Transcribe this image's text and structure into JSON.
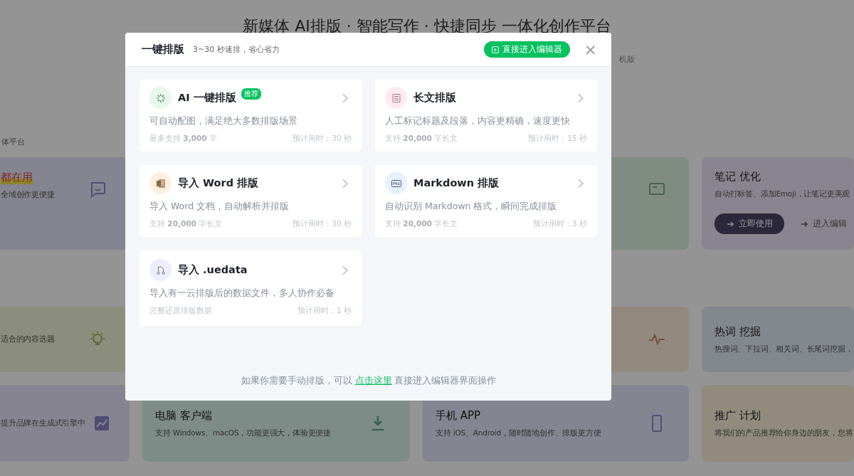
{
  "page": {
    "headline": "新媒体 AI排版 · 智能写作 · 快捷同步 一体化创作平台",
    "subtitle": "机版",
    "section_label": "体平台",
    "rows": [
      [
        {
          "title": "都在用",
          "highlighted": true,
          "description": "全域创作更便捷"
        },
        {
          "title": "笔记 优化",
          "highlighted": false,
          "description": "自动打标签、添加Emoji，让笔记更美观",
          "primary_button": "立即使用",
          "secondary_link": "进入编辑"
        }
      ],
      [
        {
          "description": "适合的内容选题"
        },
        {
          "title": "热词 挖掘",
          "highlighted": false,
          "description": "热搜词、下拉词、相关词、长尾词挖掘，"
        }
      ],
      [
        {
          "description": "提升品牌在生成式引擎中"
        },
        {
          "title": "电脑 客户端",
          "highlighted": false,
          "description": "支持 Windows、macOS，功能更强大，体验更便捷"
        },
        {
          "title": "手机 APP",
          "highlighted": false,
          "description": "支持 iOS、Android，随时随地创作、排版更方便"
        },
        {
          "title": "推广 计划",
          "highlighted": false,
          "description": "将我们的产品推荐给你身边的朋友，您将"
        }
      ]
    ]
  },
  "dialog": {
    "title": "一键排版",
    "subtitle": "3~30 秒速排，省心省力",
    "editor_button": "直接进入编辑器",
    "close": "×",
    "options": [
      {
        "title": "AI 一键排版",
        "badge": "推荐",
        "description": "可自动配图，满足绝大多数排版场景",
        "limit": "最多支持 **3,000** 字",
        "time": "预计用时：30 秒",
        "color": "#e6f9ec"
      },
      {
        "title": "长文排版",
        "description": "人工标记标题及段落，内容更精确，速度更快",
        "limit": "支持 **20,000** 字长文",
        "time": "预计用时：15 秒",
        "color": "#fdecef"
      },
      {
        "title": "导入 Word 排版",
        "description": "导入 Word 文档，自动解析并排版",
        "limit": "支持 **20,000** 字长文",
        "time": "预计用时：30 秒",
        "color": "#fdf0e0"
      },
      {
        "title": "Markdown 排版",
        "description": "自动识别 Markdown 格式，瞬间完成排版",
        "limit": "支持 **20,000** 字长文",
        "time": "预计用时：3 秒",
        "color": "#e6f2fc"
      },
      {
        "title": "导入 .uedata",
        "description": "导入有一云排版后的数据文件，多人协作必备",
        "limit": "完整还原排版数据",
        "time": "预计用时：1 秒",
        "color": "#eceefb"
      }
    ],
    "footer": {
      "before": "如果你需要手动排版，可以",
      "link": "点击这里",
      "after": "直接进入编辑器界面操作"
    }
  }
}
